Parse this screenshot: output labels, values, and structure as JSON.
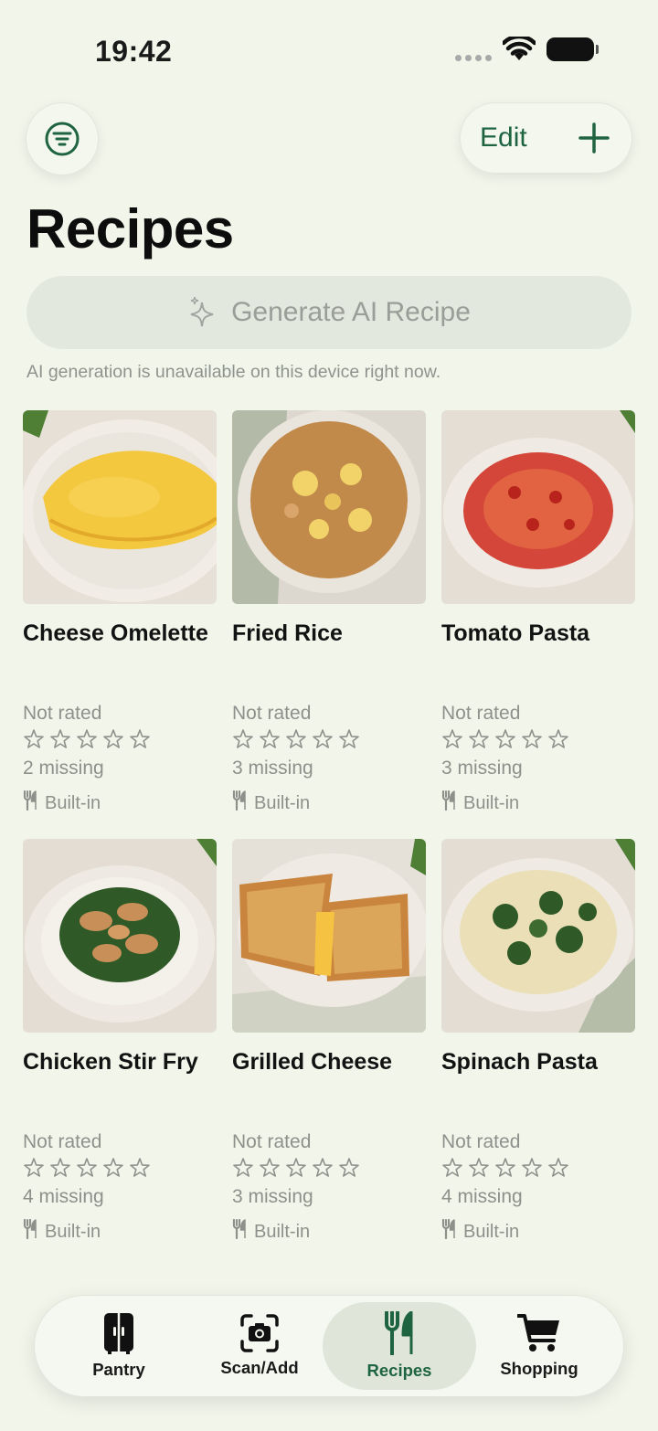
{
  "status_bar": {
    "time": "19:42"
  },
  "header": {
    "edit_label": "Edit",
    "title": "Recipes"
  },
  "ai": {
    "button_label": "Generate AI Recipe",
    "note": "AI generation is unavailable on this device right now."
  },
  "recipes": [
    {
      "name": "Cheese Omelette",
      "rating": "Not rated",
      "stars": 0,
      "missing": "2 missing",
      "source": "Built-in",
      "image": "cheese omelette on plate"
    },
    {
      "name": "Fried Rice",
      "rating": "Not rated",
      "stars": 0,
      "missing": "3 missing",
      "source": "Built-in",
      "image": "fried rice in bowl"
    },
    {
      "name": "Tomato Pasta",
      "rating": "Not rated",
      "stars": 0,
      "missing": "3 missing",
      "source": "Built-in",
      "image": "tomato spaghetti in bowl"
    },
    {
      "name": "Chicken Stir Fry",
      "rating": "Not rated",
      "stars": 0,
      "missing": "4 missing",
      "source": "Built-in",
      "image": "chicken and spinach over rice"
    },
    {
      "name": "Grilled Cheese",
      "rating": "Not rated",
      "stars": 0,
      "missing": "3 missing",
      "source": "Built-in",
      "image": "grilled cheese sandwich"
    },
    {
      "name": "Spinach Pasta",
      "rating": "Not rated",
      "stars": 0,
      "missing": "4 missing",
      "source": "Built-in",
      "image": "spinach pasta in bowl"
    }
  ],
  "tabs": [
    {
      "label": "Pantry",
      "icon": "fridge-icon",
      "active": false
    },
    {
      "label": "Scan/Add",
      "icon": "camera-scan-icon",
      "active": false
    },
    {
      "label": "Recipes",
      "icon": "fork-knife-icon",
      "active": true
    },
    {
      "label": "Shopping",
      "icon": "cart-icon",
      "active": false
    }
  ],
  "colors": {
    "accent": "#1f6440",
    "background": "#f1f5ea",
    "muted_text": "#8e918b"
  }
}
